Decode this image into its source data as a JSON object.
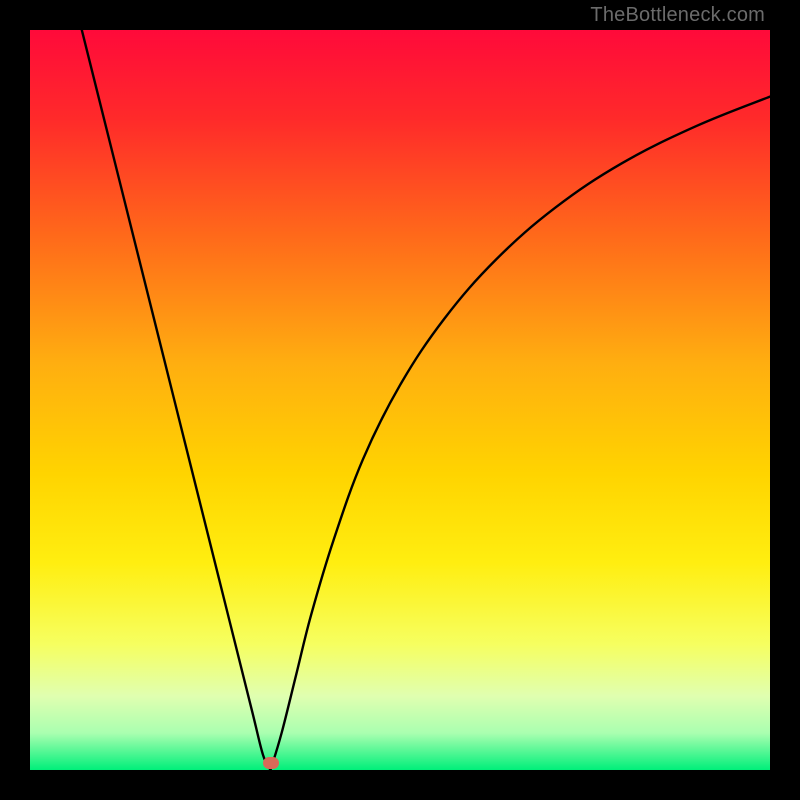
{
  "watermark": "TheBottleneck.com",
  "gradient_stops": [
    {
      "offset": 0.0,
      "color": "#ff0a3a"
    },
    {
      "offset": 0.12,
      "color": "#ff2a2a"
    },
    {
      "offset": 0.28,
      "color": "#ff6a1a"
    },
    {
      "offset": 0.45,
      "color": "#ffae10"
    },
    {
      "offset": 0.6,
      "color": "#ffd400"
    },
    {
      "offset": 0.72,
      "color": "#ffee10"
    },
    {
      "offset": 0.83,
      "color": "#f6ff60"
    },
    {
      "offset": 0.9,
      "color": "#e0ffb0"
    },
    {
      "offset": 0.95,
      "color": "#aaffb0"
    },
    {
      "offset": 1.0,
      "color": "#00ef7a"
    }
  ],
  "marker": {
    "x_pct": 32.5,
    "y_pct": 99.0,
    "color": "#d86a58"
  },
  "chart_data": {
    "type": "line",
    "title": "",
    "xlabel": "",
    "ylabel": "",
    "xlim": [
      0,
      100
    ],
    "ylim": [
      0,
      100
    ],
    "series": [
      {
        "name": "left-branch",
        "x": [
          7,
          9,
          12,
          15,
          18,
          21,
          24,
          27,
          30,
          31.5,
          32.5
        ],
        "y": [
          100,
          92,
          80,
          68,
          56,
          44,
          32,
          20,
          8,
          2,
          0
        ]
      },
      {
        "name": "right-branch",
        "x": [
          32.5,
          34,
          36,
          38,
          41,
          45,
          50,
          56,
          63,
          71,
          80,
          90,
          100
        ],
        "y": [
          0,
          5,
          13,
          21,
          31,
          42,
          52,
          61,
          69,
          76,
          82,
          87,
          91
        ]
      }
    ],
    "annotations": [
      {
        "text": "TheBottleneck.com",
        "position": "top-right"
      }
    ],
    "optimum_marker": {
      "x": 32.5,
      "y": 0
    }
  }
}
